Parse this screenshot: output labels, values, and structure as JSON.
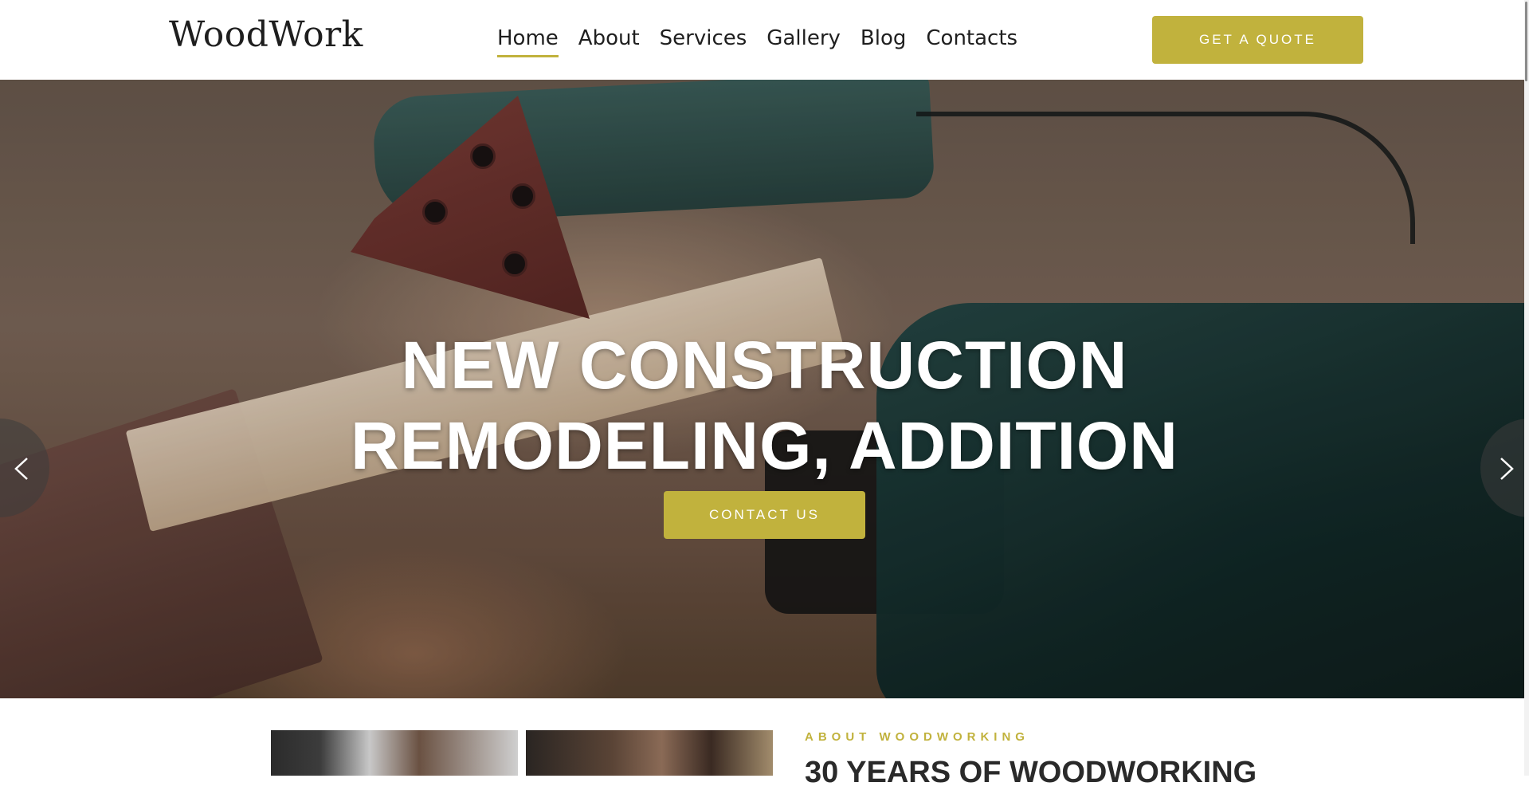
{
  "header": {
    "logo": "WoodWork",
    "nav": [
      {
        "label": "Home",
        "active": true
      },
      {
        "label": "About",
        "active": false
      },
      {
        "label": "Services",
        "active": false
      },
      {
        "label": "Gallery",
        "active": false
      },
      {
        "label": "Blog",
        "active": false
      },
      {
        "label": "Contacts",
        "active": false
      }
    ],
    "quote_button": "GET A QUOTE"
  },
  "hero": {
    "title_line1": "NEW CONSTRUCTION",
    "title_line2": "REMODELING, ADDITION",
    "cta_button": "CONTACT US",
    "prev_icon": "chevron-left-icon",
    "next_icon": "chevron-right-icon"
  },
  "about": {
    "kicker": "ABOUT WOODWORKING",
    "heading": "30 YEARS OF WOODWORKING"
  },
  "colors": {
    "accent": "#c1b23d",
    "text_dark": "#1f1f1f",
    "white": "#ffffff"
  }
}
